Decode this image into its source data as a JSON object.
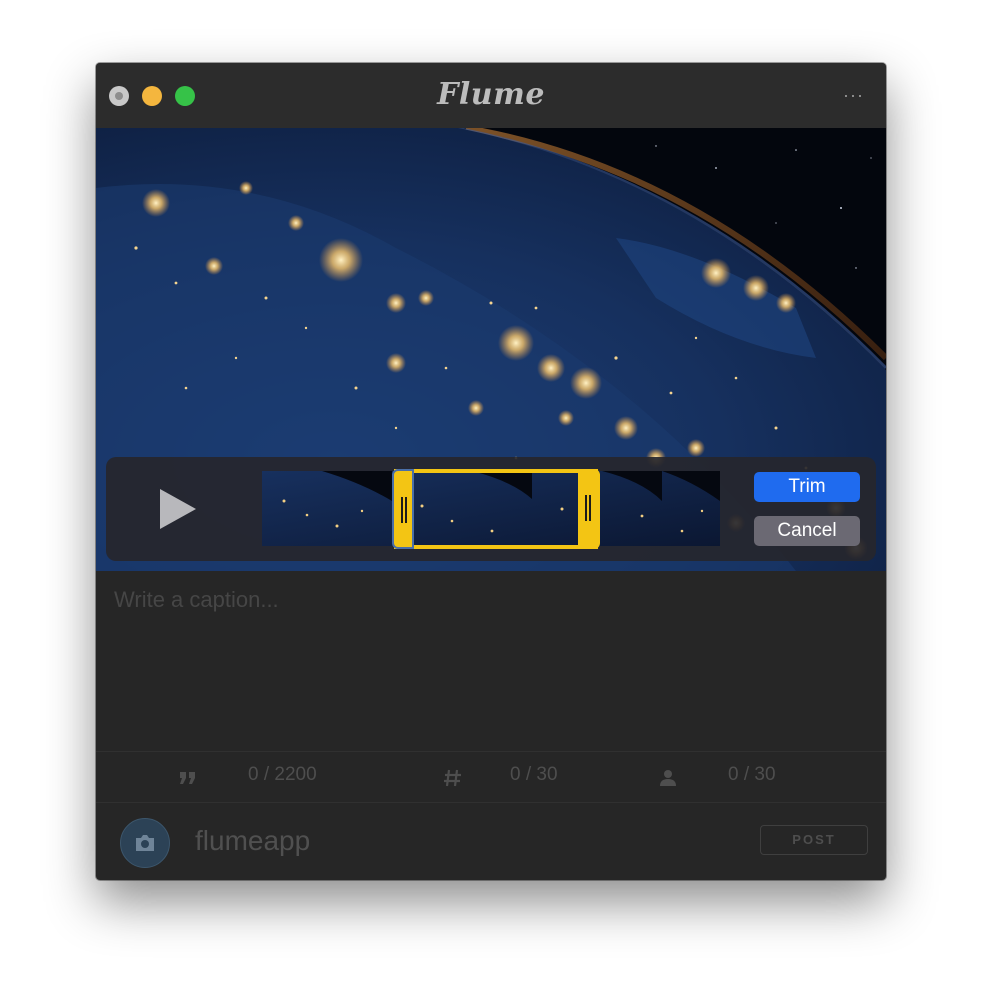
{
  "window": {
    "title": "Flume",
    "more_label": "···",
    "controls": [
      "close",
      "minimize",
      "maximize"
    ]
  },
  "media": {
    "description_icon": "earth-night-video",
    "play_icon": "play-icon",
    "trim": {
      "trim_label": "Trim",
      "cancel_label": "Cancel",
      "selection_start": 0.29,
      "selection_end": 0.73
    }
  },
  "caption": {
    "placeholder": "Write a caption...",
    "value": ""
  },
  "stats": {
    "characters": {
      "icon": "quote-icon",
      "count": "0 / 2200"
    },
    "hashtags": {
      "icon": "hashtag-icon",
      "count": "0 / 30"
    },
    "mentions": {
      "icon": "person-icon",
      "count": "0 / 30"
    }
  },
  "footer": {
    "username": "flumeapp",
    "post_label": "POST",
    "avatar_icon": "camera-icon"
  },
  "colors": {
    "accent_blue": "#1f6bef",
    "trim_yellow": "#f3c514",
    "window_bg": "#262626"
  }
}
